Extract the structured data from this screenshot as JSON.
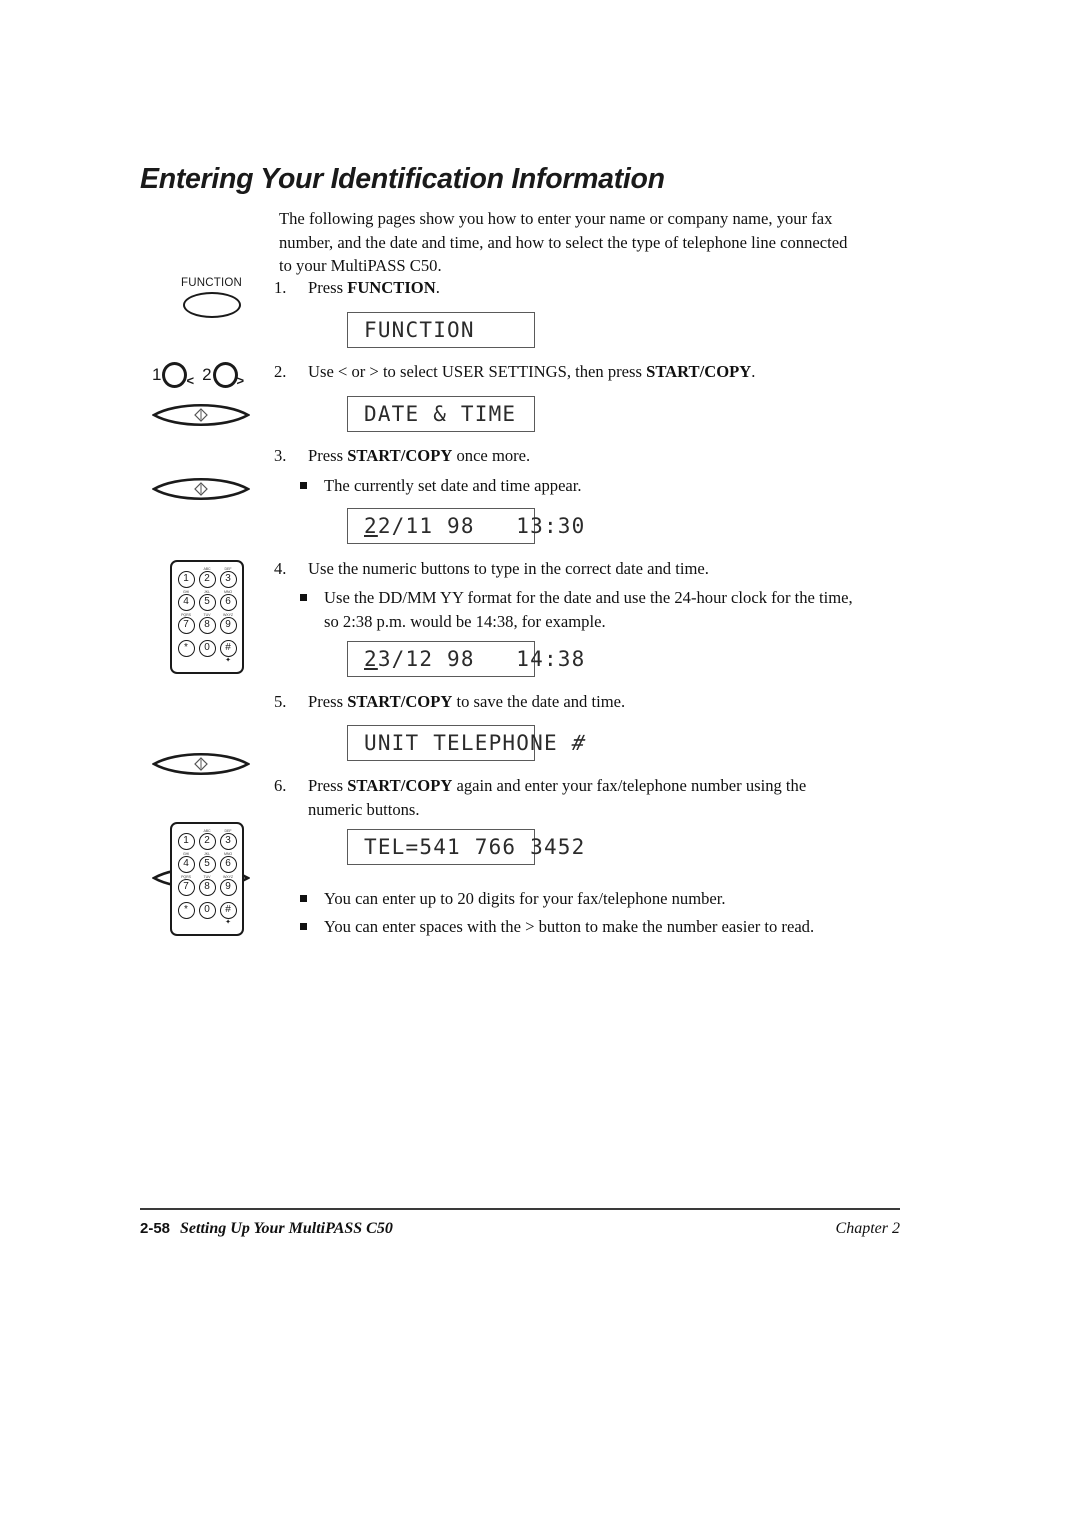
{
  "document": {
    "heading": "Entering Your Identification Information",
    "intro": "The following pages show you how to enter your name or company name, your fax number, and the date and time, and how to select the type of telephone line connected to your MultiPASS C50."
  },
  "steps": [
    {
      "number": "1.",
      "text_prefix": "Press ",
      "bold": "FUNCTION",
      "text_suffix": "."
    },
    {
      "number": "2.",
      "text_prefix": "Use < or > to select USER SETTINGS, then press ",
      "bold": "START/COPY",
      "text_suffix": "."
    },
    {
      "number": "3.",
      "text_prefix": "Press ",
      "bold": "START/COPY",
      "text_suffix": " once more."
    },
    {
      "number": "4.",
      "text_prefix": "Use the numeric buttons to type in the correct date and time.",
      "bold": "",
      "text_suffix": ""
    },
    {
      "number": "5.",
      "text_prefix": "Press ",
      "bold": "START/COPY",
      "text_suffix": " to save the date and time."
    },
    {
      "number": "6.",
      "text_prefix": "Press ",
      "bold": "START/COPY",
      "text_suffix": " again and enter your fax/telephone number using the numeric buttons."
    }
  ],
  "bullets": [
    {
      "text": "The currently set date and time appear."
    },
    {
      "text": "Use the DD/MM YY format for the date and use the 24-hour clock for the time, so 2:38 p.m. would be 14:38, for example."
    },
    {
      "text": "You can enter up to 20 digits for your fax/telephone number."
    },
    {
      "text": "You can enter spaces with the > button to make the number easier to read."
    }
  ],
  "lcd_displays": [
    {
      "name": "function-display",
      "text": "FUNCTION"
    },
    {
      "name": "date-time-menu-display",
      "text": "DATE & TIME"
    },
    {
      "name": "current-date-time-display",
      "cursor_char": "2",
      "text": "2/11 98   13:30"
    },
    {
      "name": "new-date-time-display",
      "cursor_char": "2",
      "text": "3/12 98   14:38"
    },
    {
      "name": "unit-telephone-display",
      "text": "UNIT TELEPHONE ",
      "hash": "#"
    },
    {
      "name": "tel-number-display",
      "text": "TEL=541 766 3452"
    }
  ],
  "controls": {
    "function_button_label": "FUNCTION",
    "arrow_left_digit": "1",
    "arrow_left_symbol": "<",
    "arrow_right_digit": "2",
    "arrow_right_symbol": ">"
  },
  "keypad": {
    "rows": [
      [
        {
          "letters": "",
          "digit": "1",
          "tail": ""
        },
        {
          "letters": "ABC",
          "digit": "2",
          "tail": ""
        },
        {
          "letters": "DEF",
          "digit": "3",
          "tail": ""
        }
      ],
      [
        {
          "letters": "GHI",
          "digit": "4",
          "tail": ""
        },
        {
          "letters": "JKL",
          "digit": "5",
          "tail": ""
        },
        {
          "letters": "MNO",
          "digit": "6",
          "tail": ""
        }
      ],
      [
        {
          "letters": "PQRS",
          "digit": "7",
          "tail": ""
        },
        {
          "letters": "TUV",
          "digit": "8",
          "tail": ""
        },
        {
          "letters": "WXYZ",
          "digit": "9",
          "tail": ""
        }
      ],
      [
        {
          "letters": "",
          "digit": "*",
          "tail": ""
        },
        {
          "letters": "",
          "digit": "0",
          "tail": ""
        },
        {
          "letters": "",
          "digit": "#",
          "tail": "✦"
        }
      ]
    ]
  },
  "footer": {
    "page_number": "2-58",
    "title": "Setting Up Your MultiPASS C50",
    "chapter": "Chapter 2"
  }
}
